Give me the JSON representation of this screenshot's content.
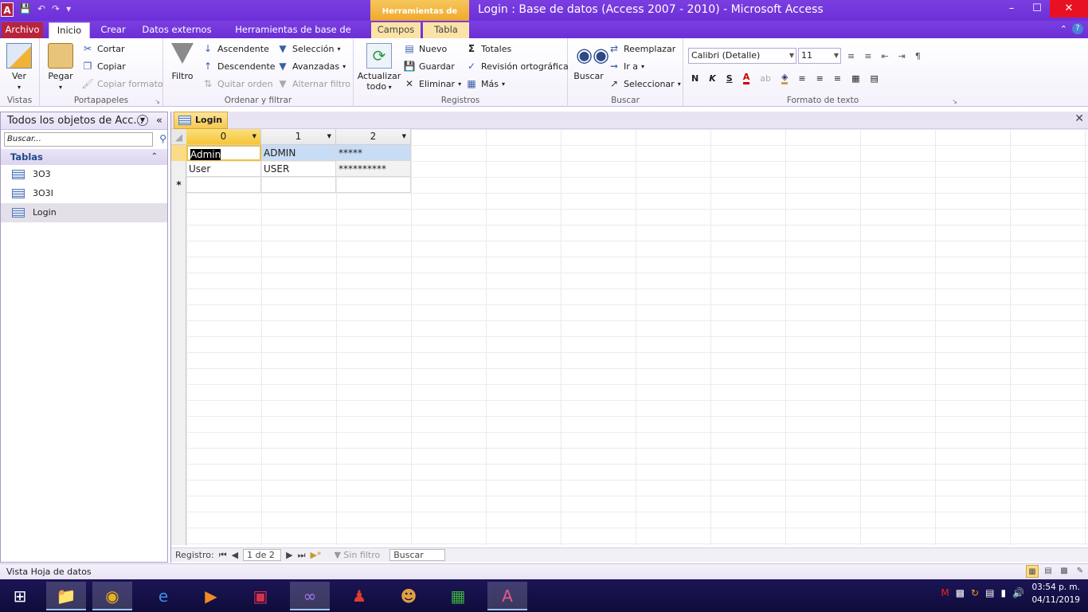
{
  "window": {
    "title": "Login : Base de datos (Access 2007 - 2010)  -  Microsoft Access",
    "context_group": "Herramientas de tabla",
    "app_icon": "A",
    "min_glyph": "–",
    "max_glyph": "☐",
    "close_glyph": "✕"
  },
  "tabs": {
    "file": "Archivo",
    "home": "Inicio",
    "create": "Crear",
    "external": "Datos externos",
    "dbtools": "Herramientas de base de datos",
    "fields": "Campos",
    "table": "Tabla"
  },
  "ribbon": {
    "views": {
      "label": "Vistas",
      "ver": "Ver"
    },
    "clipboard": {
      "label": "Portapapeles",
      "paste": "Pegar",
      "cut": "Cortar",
      "copy": "Copiar",
      "format_painter": "Copiar formato"
    },
    "sort_filter": {
      "label": "Ordenar y filtrar",
      "filter": "Filtro",
      "asc": "Ascendente",
      "desc": "Descendente",
      "remove_sort": "Quitar orden",
      "selection": "Selección",
      "advanced": "Avanzadas",
      "toggle_filter": "Alternar filtro"
    },
    "records": {
      "label": "Registros",
      "refresh": "Actualizar",
      "refresh2": "todo",
      "new": "Nuevo",
      "save": "Guardar",
      "delete": "Eliminar",
      "totals": "Totales",
      "spelling": "Revisión ortográfica",
      "more": "Más"
    },
    "find": {
      "label": "Buscar",
      "find": "Buscar",
      "replace": "Reemplazar",
      "goto": "Ir a",
      "select": "Seleccionar"
    },
    "text": {
      "label": "Formato de texto",
      "font": "Calibri (Detalle)",
      "size": "11",
      "bold": "N",
      "italic": "K",
      "underline": "S"
    }
  },
  "navpane": {
    "title": "Todos los objetos de Acc...",
    "search_placeholder": "Buscar...",
    "group": "Tablas",
    "items": [
      "3O3",
      "3O3I",
      "Login"
    ]
  },
  "document": {
    "tab": "Login",
    "columns": [
      "0",
      "1",
      "2"
    ],
    "rows": [
      [
        "Admin",
        "ADMIN",
        "*****"
      ],
      [
        "User",
        "USER",
        "**********"
      ]
    ],
    "new_row_marker": "*"
  },
  "record_nav": {
    "label": "Registro:",
    "position": "1 de 2",
    "filter": "Sin filtro",
    "search": "Buscar"
  },
  "statusbar": {
    "text": "Vista Hoja de datos"
  },
  "clock": {
    "time": "03:54 p. m.",
    "date": "04/11/2019"
  }
}
